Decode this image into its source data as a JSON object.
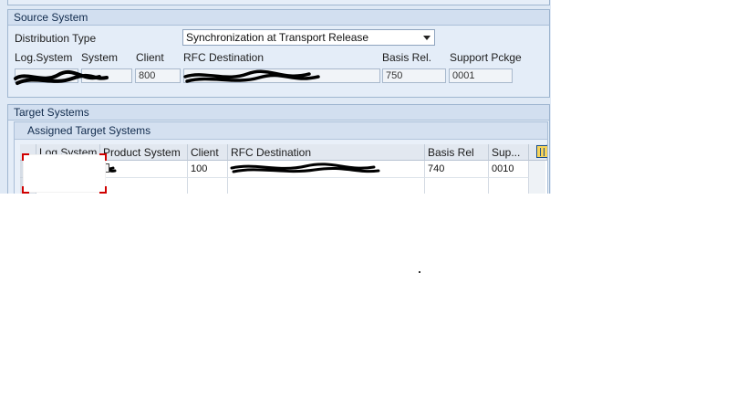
{
  "source_system": {
    "title": "Source System",
    "distribution_type_label": "Distribution Type",
    "distribution_type_value": "Synchronization at Transport Release",
    "columns": {
      "log_system": "Log.System",
      "system": "System",
      "client": "Client",
      "rfc_destination": "RFC Destination",
      "basis_rel": "Basis Rel.",
      "support_pckge": "Support Pckge"
    },
    "values": {
      "client": "800",
      "basis_rel": "750",
      "support_pckge": "0001"
    }
  },
  "target_systems": {
    "title": "Target Systems",
    "assigned_title": "Assigned Target Systems",
    "columns": [
      "Log.System",
      "Product System",
      "Client",
      "RFC Destination",
      "Basis Rel",
      "Sup..."
    ],
    "rows": [
      {
        "product_system": "7",
        "client": "100",
        "basis_rel": "740",
        "support": "0010"
      }
    ]
  },
  "colors": {
    "panel_bg": "#dfe9f5",
    "redaction": "#000000",
    "focus_corners": "#d00000",
    "column_config_icon": "#f5d35a"
  }
}
